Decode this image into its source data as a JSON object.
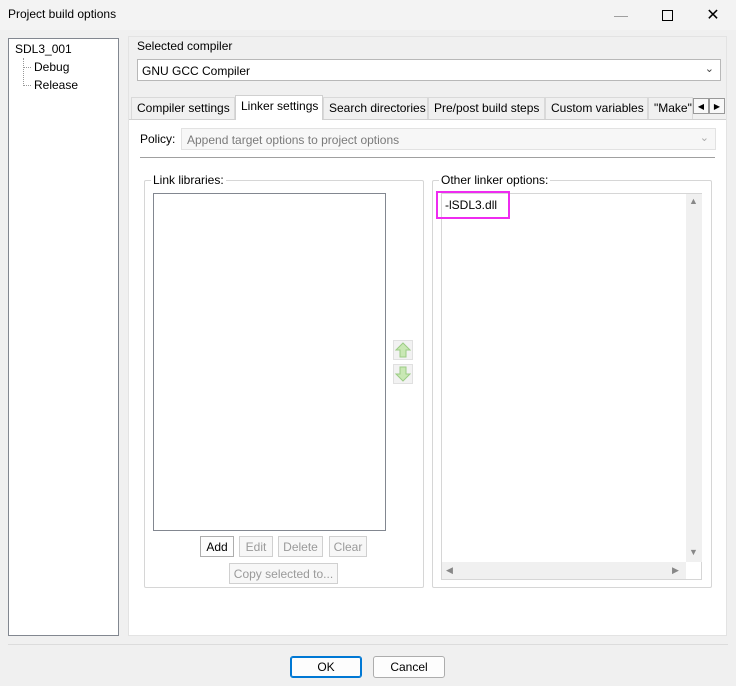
{
  "window": {
    "title": "Project build options",
    "minimize_icon": "minimize-icon",
    "maximize_icon": "maximize-icon",
    "close_icon": "close-icon"
  },
  "tree": {
    "root": "SDL3_001",
    "children": [
      "Debug",
      "Release"
    ]
  },
  "compiler": {
    "label": "Selected compiler",
    "value": "GNU GCC Compiler"
  },
  "tabs": [
    {
      "label": "Compiler settings"
    },
    {
      "label": "Linker settings"
    },
    {
      "label": "Search directories"
    },
    {
      "label": "Pre/post build steps"
    },
    {
      "label": "Custom variables"
    },
    {
      "label": "\"Make\" commands"
    }
  ],
  "active_tab": "Linker settings",
  "policy": {
    "label": "Policy:",
    "value": "Append target options to project options"
  },
  "link_libraries": {
    "label": "Link libraries:",
    "items": [],
    "buttons": {
      "add": "Add",
      "edit": "Edit",
      "delete": "Delete",
      "clear": "Clear",
      "copy": "Copy selected to..."
    }
  },
  "other_linker": {
    "label": "Other linker options:",
    "text": "-lSDL3.dll",
    "highlight_color": "#ee2bf0"
  },
  "footer": {
    "ok": "OK",
    "cancel": "Cancel"
  }
}
